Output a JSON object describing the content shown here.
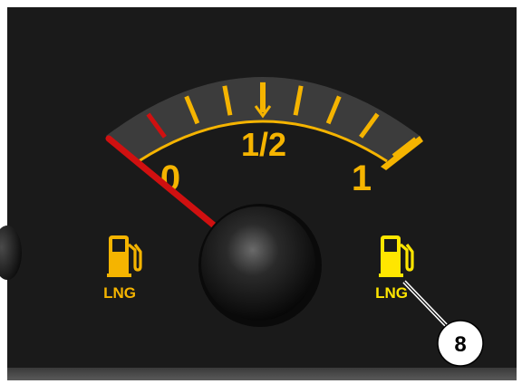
{
  "gauge": {
    "type": "fuel-gauge",
    "labels": {
      "empty": "0",
      "half": "1/2",
      "full": "1"
    },
    "needle_level": 0,
    "tick_levels": [
      0,
      0.125,
      0.25,
      0.375,
      0.5,
      0.625,
      0.75,
      0.875,
      1
    ],
    "reserve_tick_level": 0.125,
    "colors": {
      "accent": "#f5b400",
      "needle": "#d01010",
      "reserve": "#d01010",
      "panel": "#1a1a1a",
      "indicator_lit": "#ffe600"
    }
  },
  "indicators": {
    "left": {
      "icon": "fuel-pump-icon",
      "label": "LNG",
      "state": "inactive"
    },
    "right": {
      "icon": "fuel-pump-icon",
      "label": "LNG",
      "state": "lit"
    }
  },
  "callout": {
    "number": "8"
  }
}
